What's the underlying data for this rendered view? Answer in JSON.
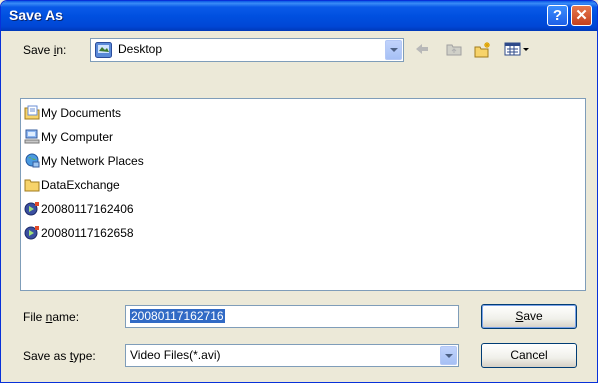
{
  "window": {
    "title": "Save As"
  },
  "save_in": {
    "label_pre": "Save ",
    "label_mnemonic": "i",
    "label_post": "n:",
    "value": "Desktop"
  },
  "files": [
    {
      "name": "My Documents",
      "icon": "my-documents-icon"
    },
    {
      "name": "My Computer",
      "icon": "my-computer-icon"
    },
    {
      "name": "My Network Places",
      "icon": "network-places-icon"
    },
    {
      "name": "DataExchange",
      "icon": "folder-icon"
    },
    {
      "name": "20080117162406",
      "icon": "media-file-icon"
    },
    {
      "name": "20080117162658",
      "icon": "media-file-icon"
    }
  ],
  "file_name": {
    "label_pre": "File ",
    "label_mnemonic": "n",
    "label_post": "ame:",
    "value": "20080117162716"
  },
  "save_as_type": {
    "label_pre": "Save as ",
    "label_mnemonic": "t",
    "label_post": "ype:",
    "value": "Video Files(*.avi)"
  },
  "buttons": {
    "save_mnemonic": "S",
    "save_rest": "ave",
    "cancel": "Cancel"
  },
  "colors": {
    "titlebar": "#0050e0",
    "selection": "#316ac5",
    "dialog_bg": "#ece9d8"
  }
}
